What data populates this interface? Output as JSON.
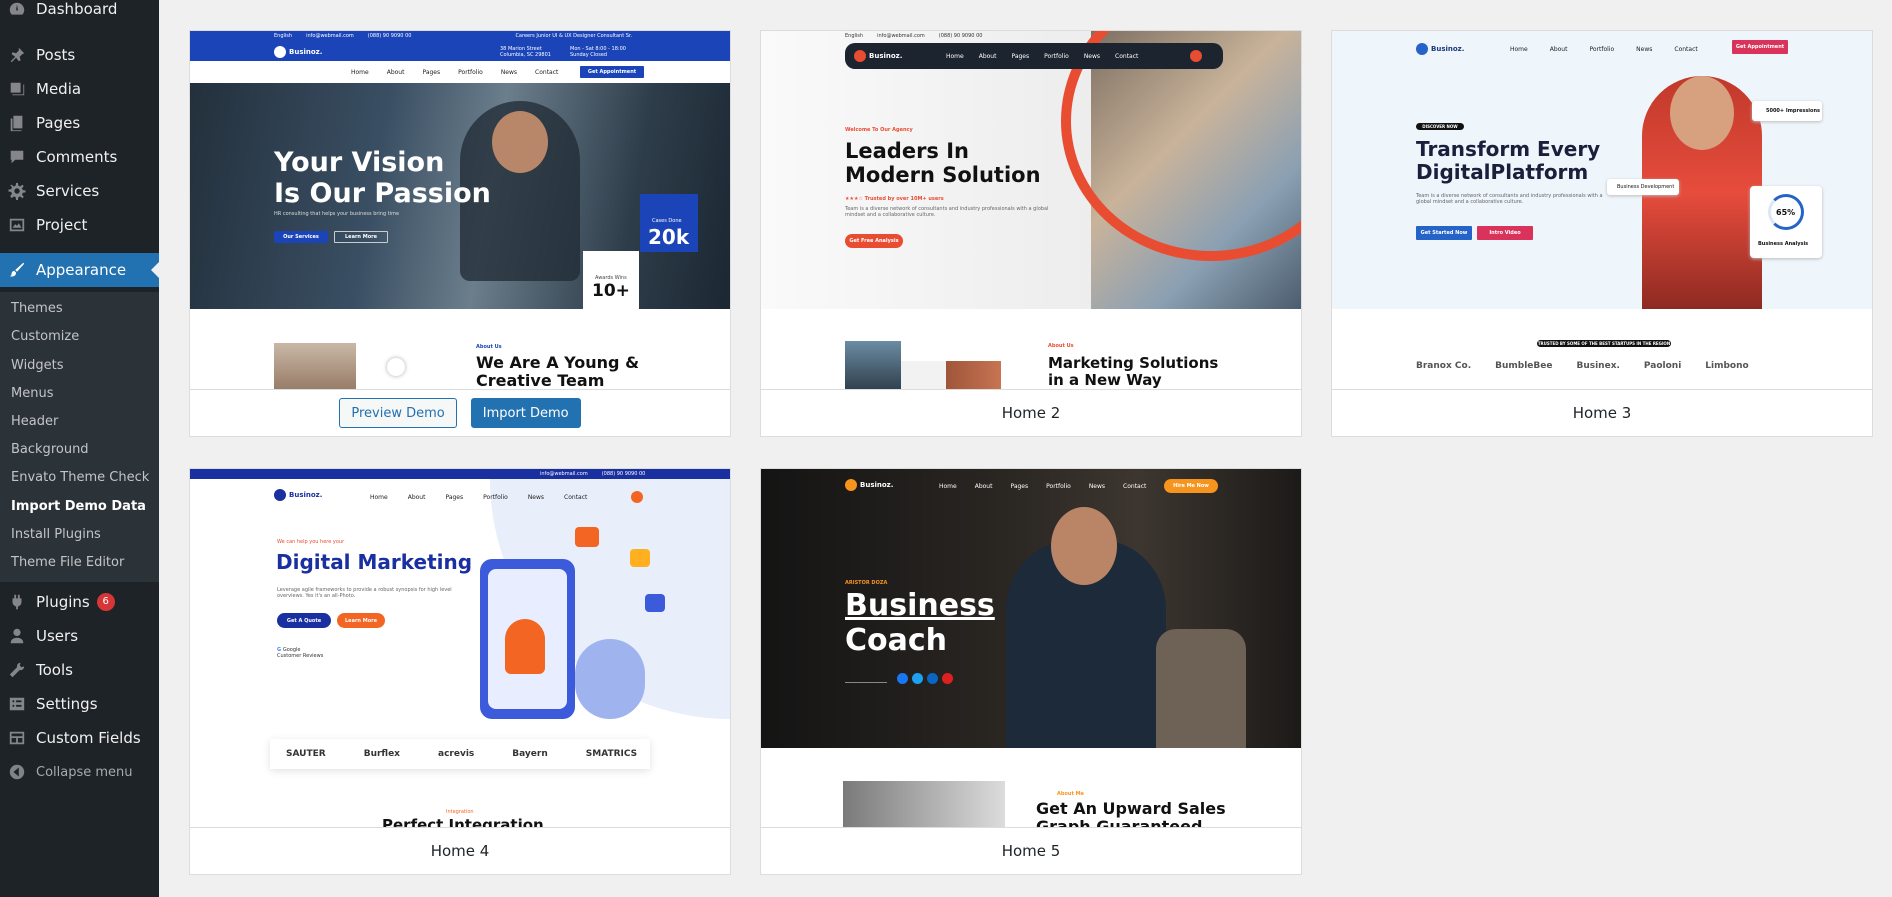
{
  "sidebar": {
    "items": [
      {
        "label": "Dashboard",
        "icon": "dashboard-icon"
      },
      {
        "label": "Posts",
        "icon": "pushpin-icon"
      },
      {
        "label": "Media",
        "icon": "media-icon"
      },
      {
        "label": "Pages",
        "icon": "pages-icon"
      },
      {
        "label": "Comments",
        "icon": "comments-icon"
      },
      {
        "label": "Services",
        "icon": "gear-icon"
      },
      {
        "label": "Project",
        "icon": "project-icon"
      },
      {
        "label": "Appearance",
        "icon": "paintbrush-icon"
      },
      {
        "label": "Plugins",
        "icon": "plugin-icon",
        "badge": "6"
      },
      {
        "label": "Users",
        "icon": "users-icon"
      },
      {
        "label": "Tools",
        "icon": "wrench-icon"
      },
      {
        "label": "Settings",
        "icon": "settings-icon"
      },
      {
        "label": "Custom Fields",
        "icon": "custom-fields-icon"
      },
      {
        "label": "Collapse menu",
        "icon": "collapse-icon"
      }
    ],
    "submenu": [
      "Themes",
      "Customize",
      "Widgets",
      "Menus",
      "Header",
      "Background",
      "Envato Theme Check",
      "Import Demo Data",
      "Install Plugins",
      "Theme File Editor"
    ]
  },
  "demos": {
    "preview_label": "Preview Demo",
    "import_label": "Import Demo",
    "home2": "Home 2",
    "home3": "Home 3",
    "home4": "Home 4",
    "home5": "Home 5"
  },
  "shot1": {
    "topbar": [
      "English",
      "info@webmail.com",
      "(088) 90 9090 00",
      "Careers Junior UI & UX Designer Consultant Sr."
    ],
    "brand": "Businoz.",
    "address": "38 Marion Street Columbia, SC 29801",
    "hours": "Mon - Sat 8:00 - 18:00 Sunday Closed",
    "nav": [
      "Home",
      "About",
      "Pages",
      "Portfolio",
      "News",
      "Contact"
    ],
    "cta": "Get Appointment",
    "title_line1": "Your Vision",
    "title_line2": "Is Our Passion",
    "sub": "HR consulting that helps your business bring time",
    "btn1": "Our Services",
    "btn2": "Learn More",
    "cases_label": "Cases Done",
    "cases_value": "20k",
    "awards_label": "Awards Wins",
    "awards_value": "10+",
    "about": "About Us",
    "heading_line1": "We Are A Young &",
    "heading_line2": "Creative Team"
  },
  "shot2": {
    "topbar": [
      "English",
      "info@webmail.com",
      "(088) 90 9090 00"
    ],
    "brand": "Businoz.",
    "nav": [
      "Home",
      "About",
      "Pages",
      "Portfolio",
      "News",
      "Contact"
    ],
    "tag": "Welcome To Our Agency",
    "title_line1": "Leaders In",
    "title_line2": "Modern Solution",
    "trusted": "Trusted by over 10M+ users",
    "desc": "Team is a diverse network of consultants and industry professionals with a global mindset and a collaborative culture.",
    "btn": "Get Free Analysis",
    "about": "About Us",
    "heading_line1": "Marketing Solutions",
    "heading_line2": "in a New Way"
  },
  "shot3": {
    "brand": "Businoz.",
    "nav": [
      "Home",
      "About",
      "Portfolio",
      "News",
      "Contact"
    ],
    "cta": "Get Appointment",
    "tag": "DISCOVER NOW",
    "title_line1": "Transform Every",
    "title_line2a": "Digital",
    "title_line2b": "Platform",
    "desc": "Team is a diverse network of consultants and industry professionals with a global mindset and a collaborative culture.",
    "btn1": "Get Started Now",
    "btn2": "Intro Video",
    "impressions": "5000+ Impressions",
    "dev": "Business Development",
    "percent": "65%",
    "analysis": "Business Analysis",
    "trusted": "TRUSTED BY SOME OF THE BEST STARTUPS IN THE REGION",
    "logos": [
      "Branox Co.",
      "BumbleBee",
      "Businex.",
      "Paoloni",
      "Limbono"
    ]
  },
  "shot4": {
    "topbar": [
      "info@webmail.com",
      "(088) 90 9090 00"
    ],
    "brand": "Businoz.",
    "nav": [
      "Home",
      "About",
      "Pages",
      "Portfolio",
      "News",
      "Contact"
    ],
    "tag": "We can help you here your",
    "title": "Digital Marketing",
    "desc": "Leverage agile frameworks to provide a robust synopsis for high level overviews. Yes it's an all-Photo.",
    "btn1": "Get A Quote",
    "btn2": "Learn More",
    "google1": "Google",
    "google2": "Customer Reviews",
    "logos": [
      "SAUTER",
      "Burflex",
      "acrevis",
      "Bayern",
      "SMATRICS"
    ],
    "integration": "Integration",
    "heading": "Perfect Integration"
  },
  "shot5": {
    "brand": "Businoz.",
    "nav": [
      "Home",
      "About",
      "Pages",
      "Portfolio",
      "News",
      "Contact"
    ],
    "cta": "Hire Me Now",
    "name": "ARISTOR DOZA",
    "title_line1": "Business",
    "title_line2": "Coach",
    "about": "About Me",
    "heading_line1": "Get An Upward Sales",
    "heading_line2": "Graph Guaranteed"
  },
  "colors": {
    "sidebar_bg": "#1d2327",
    "submenu_bg": "#2c3338",
    "accent": "#2271b1",
    "badge": "#d63638",
    "page_bg": "#f0f0f1",
    "brand_blue": "#1a44b8",
    "brand_red": "#e84d32",
    "orange": "#f7941d",
    "pink": "#d9335b"
  }
}
